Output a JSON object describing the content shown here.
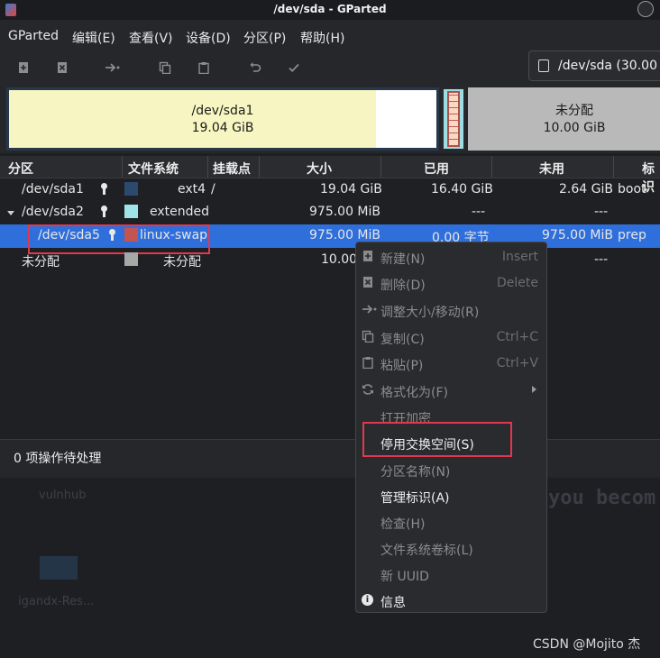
{
  "window": {
    "title": "/dev/sda - GParted"
  },
  "menubar": {
    "items": [
      "GParted",
      "编辑(E)",
      "查看(V)",
      "设备(D)",
      "分区(P)",
      "帮助(H)"
    ]
  },
  "toolbar": {
    "icons": [
      "new-icon",
      "delete-icon",
      "resize-icon",
      "copy-icon",
      "paste-icon",
      "undo-icon",
      "apply-icon"
    ],
    "device_selector": "/dev/sda (30.00 G"
  },
  "disk_map": {
    "sda1": {
      "name": "/dev/sda1",
      "size": "19.04 GiB"
    },
    "unallocated": {
      "name": "未分配",
      "size": "10.00 GiB"
    }
  },
  "table": {
    "headers": [
      "分区",
      "文件系统",
      "挂载点",
      "大小",
      "已用",
      "未用",
      "标识"
    ],
    "rows": [
      {
        "partition": "/dev/sda1",
        "fs": "ext4",
        "mount": "/",
        "size": "19.04 GiB",
        "used": "16.40 GiB",
        "unused": "2.64 GiB",
        "flags": "boot",
        "color": "#2c4a6e"
      },
      {
        "partition": "/dev/sda2",
        "fs": "extended",
        "mount": "",
        "size": "975.00 MiB",
        "used": "---",
        "unused": "---",
        "flags": "",
        "color": "#9fe3ea"
      },
      {
        "partition": "/dev/sda5",
        "fs": "linux-swap",
        "mount": "",
        "size": "975.00 MiB",
        "used": "0.00 字节",
        "unused": "975.00 MiB",
        "flags": "prep",
        "color": "#c25452"
      },
      {
        "partition": "未分配",
        "fs": "未分配",
        "mount": "",
        "size": "10.00",
        "used": "",
        "unused": "---",
        "flags": "",
        "color": "#a8a8a8"
      }
    ]
  },
  "status": {
    "text": "0 项操作待处理"
  },
  "context_menu": {
    "items": [
      {
        "label": "新建(N)",
        "accel": "Insert",
        "icon": "new-icon"
      },
      {
        "label": "删除(D)",
        "accel": "Delete",
        "icon": "delete-icon"
      },
      {
        "label": "调整大小/移动(R)",
        "accel": "",
        "icon": "resize-icon"
      },
      {
        "label": "复制(C)",
        "accel": "Ctrl+C",
        "icon": "copy-icon"
      },
      {
        "label": "粘贴(P)",
        "accel": "Ctrl+V",
        "icon": "paste-icon"
      },
      {
        "label": "格式化为(F)",
        "accel": "",
        "icon": "format-icon"
      },
      {
        "label": "打开加密",
        "accel": "",
        "icon": ""
      },
      {
        "label": "停用交换空间(S)",
        "accel": "",
        "icon": ""
      },
      {
        "label": "分区名称(N)",
        "accel": "",
        "icon": ""
      },
      {
        "label": "管理标识(A)",
        "accel": "",
        "icon": ""
      },
      {
        "label": "检查(H)",
        "accel": "",
        "icon": ""
      },
      {
        "label": "文件系统卷标(L)",
        "accel": "",
        "icon": ""
      },
      {
        "label": "新 UUID",
        "accel": "",
        "icon": ""
      },
      {
        "label": "信息",
        "accel": "",
        "icon": "info-icon"
      }
    ]
  },
  "desktop": {
    "vulnhub": "vulnhub",
    "igandx": "igandx-Res...",
    "banner": "you becom",
    "watermark": "CSDN @Mojito 杰"
  }
}
